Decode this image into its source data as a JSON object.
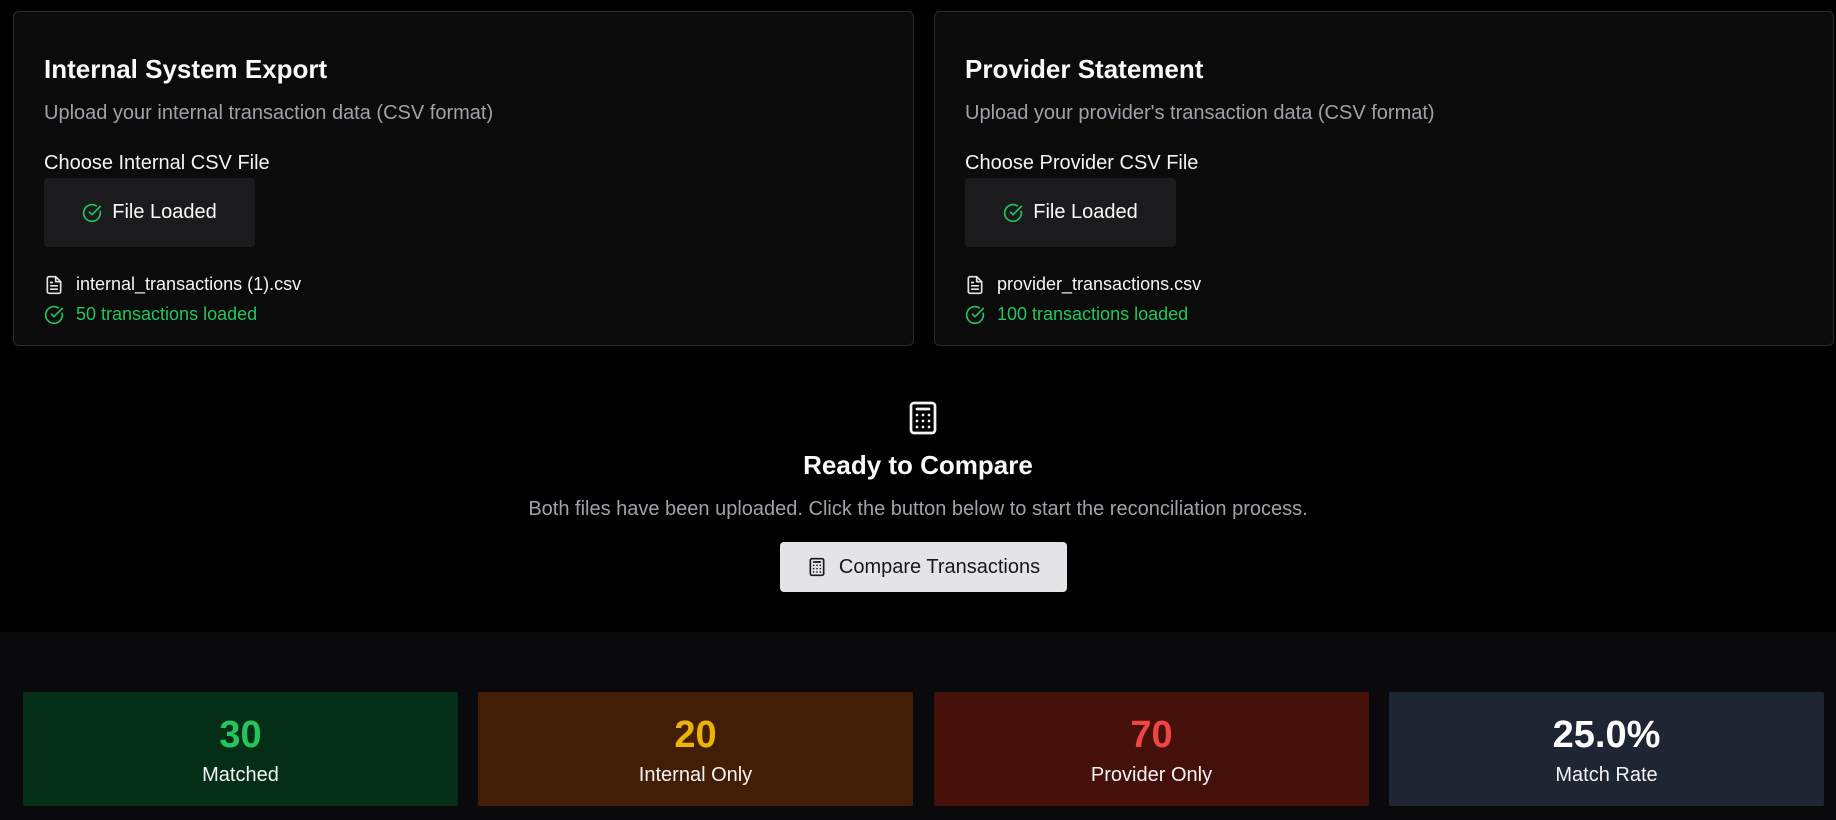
{
  "colors": {
    "success": "#22c55e",
    "warning": "#eab308",
    "danger": "#ef4444",
    "rate": "#ffffff"
  },
  "internal": {
    "title": "Internal System Export",
    "description": "Upload your internal transaction data (CSV format)",
    "choose_label": "Choose Internal CSV File",
    "button_label": "File Loaded",
    "file_name": "internal_transactions (1).csv",
    "count_text": "50 transactions loaded",
    "icons": [
      "check-circle-icon",
      "file-text-icon",
      "check-circle-icon"
    ]
  },
  "provider": {
    "title": "Provider Statement",
    "description": "Upload your provider's transaction data (CSV format)",
    "choose_label": "Choose Provider CSV File",
    "button_label": "File Loaded",
    "file_name": "provider_transactions.csv",
    "count_text": "100 transactions loaded",
    "icons": [
      "check-circle-icon",
      "file-text-icon",
      "check-circle-icon"
    ]
  },
  "compare": {
    "title": "Ready to Compare",
    "description": "Both files have been uploaded. Click the button below to start the reconciliation process.",
    "button_label": "Compare Transactions",
    "icon": "calculator-icon"
  },
  "stats": {
    "matched": {
      "value": "30",
      "label": "Matched"
    },
    "internal_only": {
      "value": "20",
      "label": "Internal Only"
    },
    "provider_only": {
      "value": "70",
      "label": "Provider Only"
    },
    "match_rate": {
      "value": "25.0%",
      "label": "Match Rate"
    }
  }
}
